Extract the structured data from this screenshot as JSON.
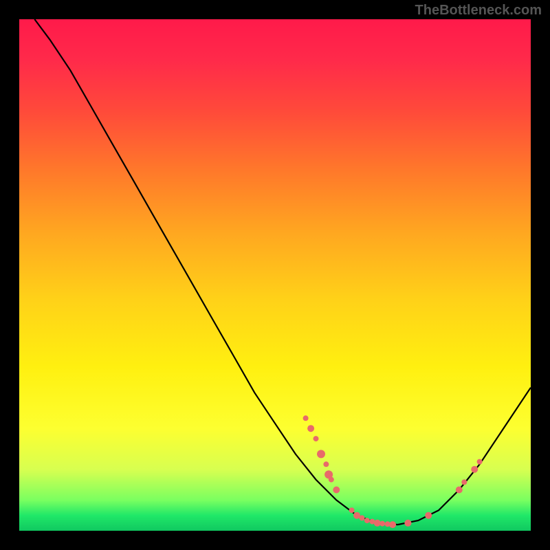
{
  "watermark": "TheBottleneck.com",
  "chart_data": {
    "type": "line",
    "title": "",
    "xlabel": "",
    "ylabel": "",
    "xlim": [
      0,
      100
    ],
    "ylim": [
      0,
      100
    ],
    "curve": [
      {
        "x": 3,
        "y": 100
      },
      {
        "x": 6,
        "y": 96
      },
      {
        "x": 10,
        "y": 90
      },
      {
        "x": 14,
        "y": 83
      },
      {
        "x": 18,
        "y": 76
      },
      {
        "x": 22,
        "y": 69
      },
      {
        "x": 26,
        "y": 62
      },
      {
        "x": 30,
        "y": 55
      },
      {
        "x": 34,
        "y": 48
      },
      {
        "x": 38,
        "y": 41
      },
      {
        "x": 42,
        "y": 34
      },
      {
        "x": 46,
        "y": 27
      },
      {
        "x": 50,
        "y": 21
      },
      {
        "x": 54,
        "y": 15
      },
      {
        "x": 58,
        "y": 10
      },
      {
        "x": 62,
        "y": 6
      },
      {
        "x": 66,
        "y": 3
      },
      {
        "x": 70,
        "y": 1.5
      },
      {
        "x": 74,
        "y": 1.2
      },
      {
        "x": 78,
        "y": 2
      },
      {
        "x": 82,
        "y": 4
      },
      {
        "x": 86,
        "y": 8
      },
      {
        "x": 90,
        "y": 13
      },
      {
        "x": 94,
        "y": 19
      },
      {
        "x": 98,
        "y": 25
      },
      {
        "x": 100,
        "y": 28
      }
    ],
    "dots": [
      {
        "x": 56,
        "y": 22,
        "r": 4
      },
      {
        "x": 57,
        "y": 20,
        "r": 5
      },
      {
        "x": 58,
        "y": 18,
        "r": 4
      },
      {
        "x": 59,
        "y": 15,
        "r": 6
      },
      {
        "x": 60,
        "y": 13,
        "r": 4
      },
      {
        "x": 60.5,
        "y": 11,
        "r": 6
      },
      {
        "x": 61,
        "y": 10,
        "r": 4
      },
      {
        "x": 62,
        "y": 8,
        "r": 5
      },
      {
        "x": 65,
        "y": 4,
        "r": 4
      },
      {
        "x": 66,
        "y": 3,
        "r": 5
      },
      {
        "x": 67,
        "y": 2.5,
        "r": 4
      },
      {
        "x": 68,
        "y": 2,
        "r": 4
      },
      {
        "x": 69,
        "y": 1.8,
        "r": 4
      },
      {
        "x": 70,
        "y": 1.5,
        "r": 5
      },
      {
        "x": 71,
        "y": 1.4,
        "r": 4
      },
      {
        "x": 72,
        "y": 1.3,
        "r": 4
      },
      {
        "x": 73,
        "y": 1.2,
        "r": 5
      },
      {
        "x": 76,
        "y": 1.5,
        "r": 5
      },
      {
        "x": 80,
        "y": 3,
        "r": 5
      },
      {
        "x": 86,
        "y": 8,
        "r": 5
      },
      {
        "x": 87,
        "y": 9.5,
        "r": 4
      },
      {
        "x": 89,
        "y": 12,
        "r": 5
      },
      {
        "x": 90,
        "y": 13.5,
        "r": 4
      }
    ]
  }
}
